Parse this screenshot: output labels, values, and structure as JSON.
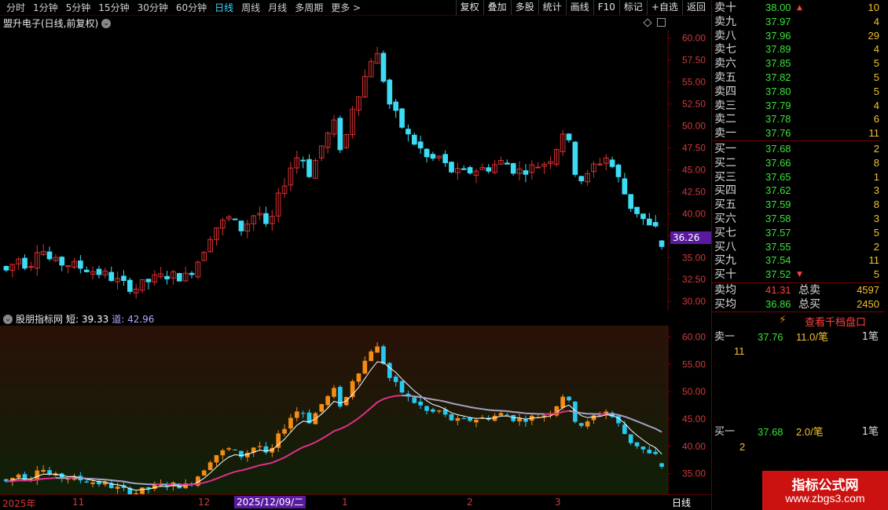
{
  "toolbar": {
    "periods": [
      "分时",
      "1分钟",
      "5分钟",
      "15分钟",
      "30分钟",
      "60分钟",
      "日线",
      "周线",
      "月线",
      "多周期",
      "更多 >"
    ],
    "active_period": "日线",
    "buttons": [
      "复权",
      "叠加",
      "多股",
      "统计",
      "画线",
      "F10",
      "标记",
      "+自选",
      "返回"
    ]
  },
  "main": {
    "title": "盟升电子(日线,前复权)",
    "price_axis": [
      "60.00",
      "57.50",
      "55.00",
      "52.50",
      "50.00",
      "47.50",
      "45.00",
      "42.50",
      "40.00",
      "37.50",
      "35.00",
      "32.50",
      "30.00"
    ],
    "current_price_tag": "36.26"
  },
  "indicator": {
    "name": "股朋指标网",
    "short_label": "短: 39.33",
    "dao_label": "道: 42.96",
    "axis": [
      "60.00",
      "55.00",
      "50.00",
      "45.00",
      "40.00",
      "35.00"
    ]
  },
  "dates": {
    "labels": [
      "2025年",
      "11",
      "12",
      "1",
      "2",
      "3"
    ],
    "highlight": "2025/12/09/二",
    "period": "日线"
  },
  "orderbook": {
    "asks": [
      {
        "label": "卖十",
        "price": "38.00",
        "vol": "10",
        "arrow": "up"
      },
      {
        "label": "卖九",
        "price": "37.97",
        "vol": "4"
      },
      {
        "label": "卖八",
        "price": "37.96",
        "vol": "29"
      },
      {
        "label": "卖七",
        "price": "37.89",
        "vol": "4"
      },
      {
        "label": "卖六",
        "price": "37.85",
        "vol": "5"
      },
      {
        "label": "卖五",
        "price": "37.82",
        "vol": "5"
      },
      {
        "label": "卖四",
        "price": "37.80",
        "vol": "5"
      },
      {
        "label": "卖三",
        "price": "37.79",
        "vol": "4"
      },
      {
        "label": "卖二",
        "price": "37.78",
        "vol": "6"
      },
      {
        "label": "卖一",
        "price": "37.76",
        "vol": "11"
      }
    ],
    "bids": [
      {
        "label": "买一",
        "price": "37.68",
        "vol": "2"
      },
      {
        "label": "买二",
        "price": "37.66",
        "vol": "8"
      },
      {
        "label": "买三",
        "price": "37.65",
        "vol": "1"
      },
      {
        "label": "买四",
        "price": "37.62",
        "vol": "3"
      },
      {
        "label": "买五",
        "price": "37.59",
        "vol": "8"
      },
      {
        "label": "买六",
        "price": "37.58",
        "vol": "3"
      },
      {
        "label": "买七",
        "price": "37.57",
        "vol": "5"
      },
      {
        "label": "买八",
        "price": "37.55",
        "vol": "2"
      },
      {
        "label": "买九",
        "price": "37.54",
        "vol": "11"
      },
      {
        "label": "买十",
        "price": "37.52",
        "vol": "5",
        "arrow": "down"
      }
    ],
    "summary": [
      {
        "label": "卖均",
        "price": "41.31",
        "label2": "总卖",
        "vol": "4597"
      },
      {
        "label": "买均",
        "price": "36.86",
        "label2": "总买",
        "vol": "2450"
      }
    ],
    "view_depth": "查看千档盘口",
    "queue_sell": {
      "label": "卖一",
      "price": "37.76",
      "vol": "11.0/笔",
      "count": "1笔",
      "sub": "11"
    },
    "queue_buy": {
      "label": "买一",
      "price": "37.68",
      "vol": "2.0/笔",
      "count": "1笔",
      "sub": "2"
    }
  },
  "watermark": {
    "line1": "指标公式网",
    "line2": "www.zbgs3.com"
  },
  "colors": {
    "up": "#ff3c3c",
    "down": "#3ddcf5",
    "ind_up": "#f58c14",
    "ind_down": "#28c8f0",
    "ma_short": "#ffffff",
    "ma_long_pink": "#e0308c",
    "ma_long_grey": "#a8a0c8"
  }
}
